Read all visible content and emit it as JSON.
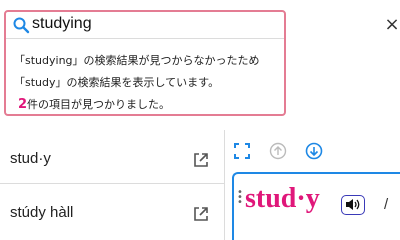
{
  "search": {
    "query": "studying",
    "message_line1": "「studying」の検索結果が見つからなかったため",
    "message_line2": "「study」の検索結果を表示しています。",
    "result_count": "2",
    "result_suffix": "件の項目が見つかりました。",
    "icon": "search-icon"
  },
  "window": {
    "close_label": "×"
  },
  "results": [
    {
      "label": "stud·y",
      "icon": "open-in-new-icon"
    },
    {
      "label": "stúdy hàll",
      "icon": "open-in-new-icon"
    }
  ],
  "detail": {
    "headword": "stud·y",
    "separator": "/",
    "toolbar_icons": [
      "fullscreen-icon",
      "arrow-up-icon",
      "arrow-down-icon"
    ],
    "speaker_icon": "speaker-icon"
  },
  "colors": {
    "highlight_border": "#e47c93",
    "accent_pink": "#e0177a",
    "accent_blue": "#1e88e5"
  }
}
